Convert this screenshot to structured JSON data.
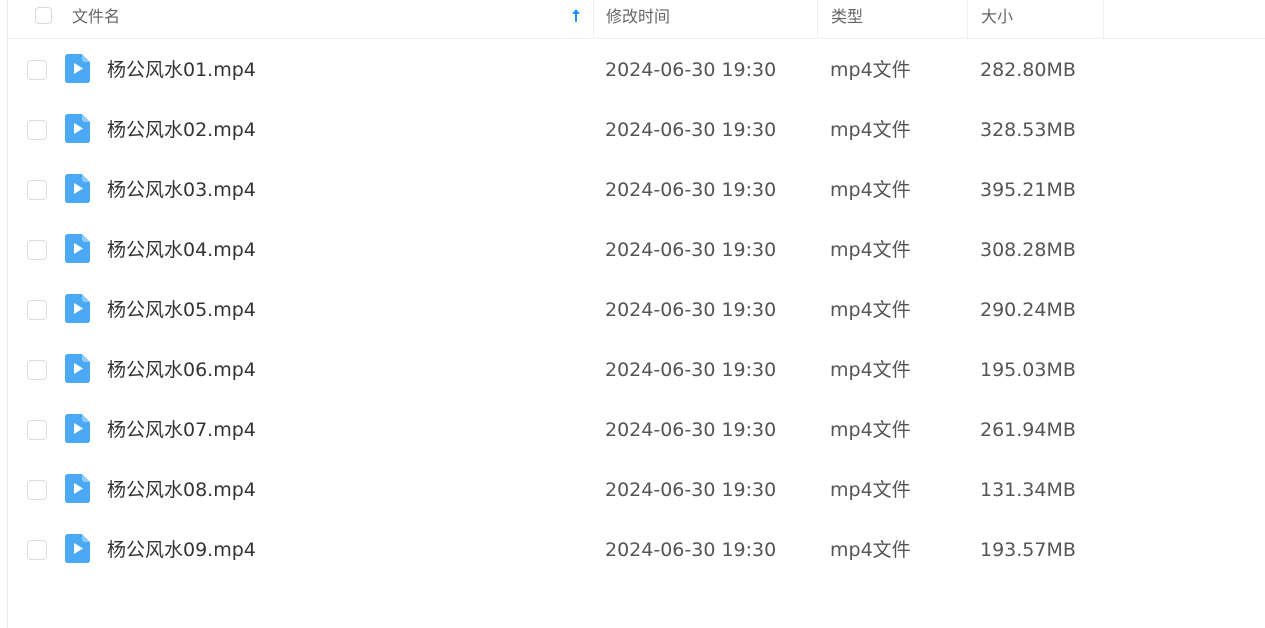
{
  "header": {
    "columns": {
      "name": "文件名",
      "modified": "修改时间",
      "type": "类型",
      "size": "大小"
    },
    "sort_icon": "arrow-up-icon",
    "sort_color": "#1e90ff"
  },
  "file_icon": {
    "name": "video-file-icon",
    "color": "#4aa8f5"
  },
  "files": [
    {
      "name": "杨公风水01.mp4",
      "modified": "2024-06-30 19:30",
      "type": "mp4文件",
      "size": "282.80MB"
    },
    {
      "name": "杨公风水02.mp4",
      "modified": "2024-06-30 19:30",
      "type": "mp4文件",
      "size": "328.53MB"
    },
    {
      "name": "杨公风水03.mp4",
      "modified": "2024-06-30 19:30",
      "type": "mp4文件",
      "size": "395.21MB"
    },
    {
      "name": "杨公风水04.mp4",
      "modified": "2024-06-30 19:30",
      "type": "mp4文件",
      "size": "308.28MB"
    },
    {
      "name": "杨公风水05.mp4",
      "modified": "2024-06-30 19:30",
      "type": "mp4文件",
      "size": "290.24MB"
    },
    {
      "name": "杨公风水06.mp4",
      "modified": "2024-06-30 19:30",
      "type": "mp4文件",
      "size": "195.03MB"
    },
    {
      "name": "杨公风水07.mp4",
      "modified": "2024-06-30 19:30",
      "type": "mp4文件",
      "size": "261.94MB"
    },
    {
      "name": "杨公风水08.mp4",
      "modified": "2024-06-30 19:30",
      "type": "mp4文件",
      "size": "131.34MB"
    },
    {
      "name": "杨公风水09.mp4",
      "modified": "2024-06-30 19:30",
      "type": "mp4文件",
      "size": "193.57MB"
    }
  ]
}
